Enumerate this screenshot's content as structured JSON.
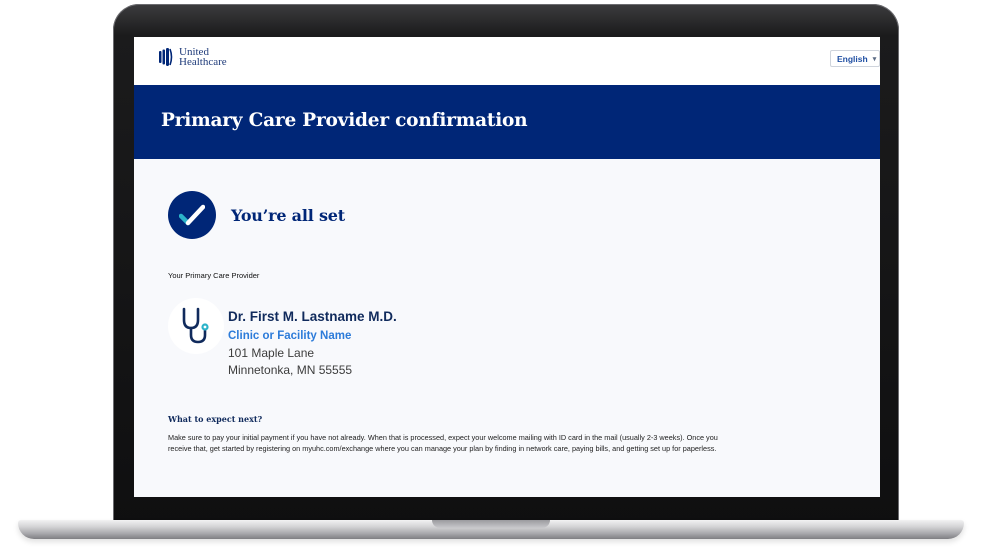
{
  "header": {
    "logo_line1": "United",
    "logo_line2": "Healthcare",
    "language": "English"
  },
  "banner": {
    "title": "Primary Care Provider confirmation"
  },
  "status": {
    "title": "You’re all set"
  },
  "provider": {
    "section_label": "Your Primary Care Provider",
    "name": "Dr. First M. Lastname M.D.",
    "facility": "Clinic or Facility Name",
    "address_line1": "101 Maple Lane",
    "address_line2": "Minnetonka, MN 55555"
  },
  "next_steps": {
    "title": "What to expect next?",
    "body": "Make sure to pay your initial payment if you have not already. When that is processed, expect your welcome mailing with ID card in the mail (usually 2-3 weeks). Once you receive that, get started by registering on myuhc.com/exchange where you can manage your plan by finding in network care, paying bills, and getting set up for paperless."
  },
  "colors": {
    "brand_navy": "#002677",
    "link_blue": "#2c7bd9",
    "accent_teal": "#2bb3c9"
  },
  "icons": {
    "check": "check-icon",
    "provider": "stethoscope-icon",
    "logo": "uhc-logo-icon",
    "dropdown": "chevron-down-icon"
  }
}
